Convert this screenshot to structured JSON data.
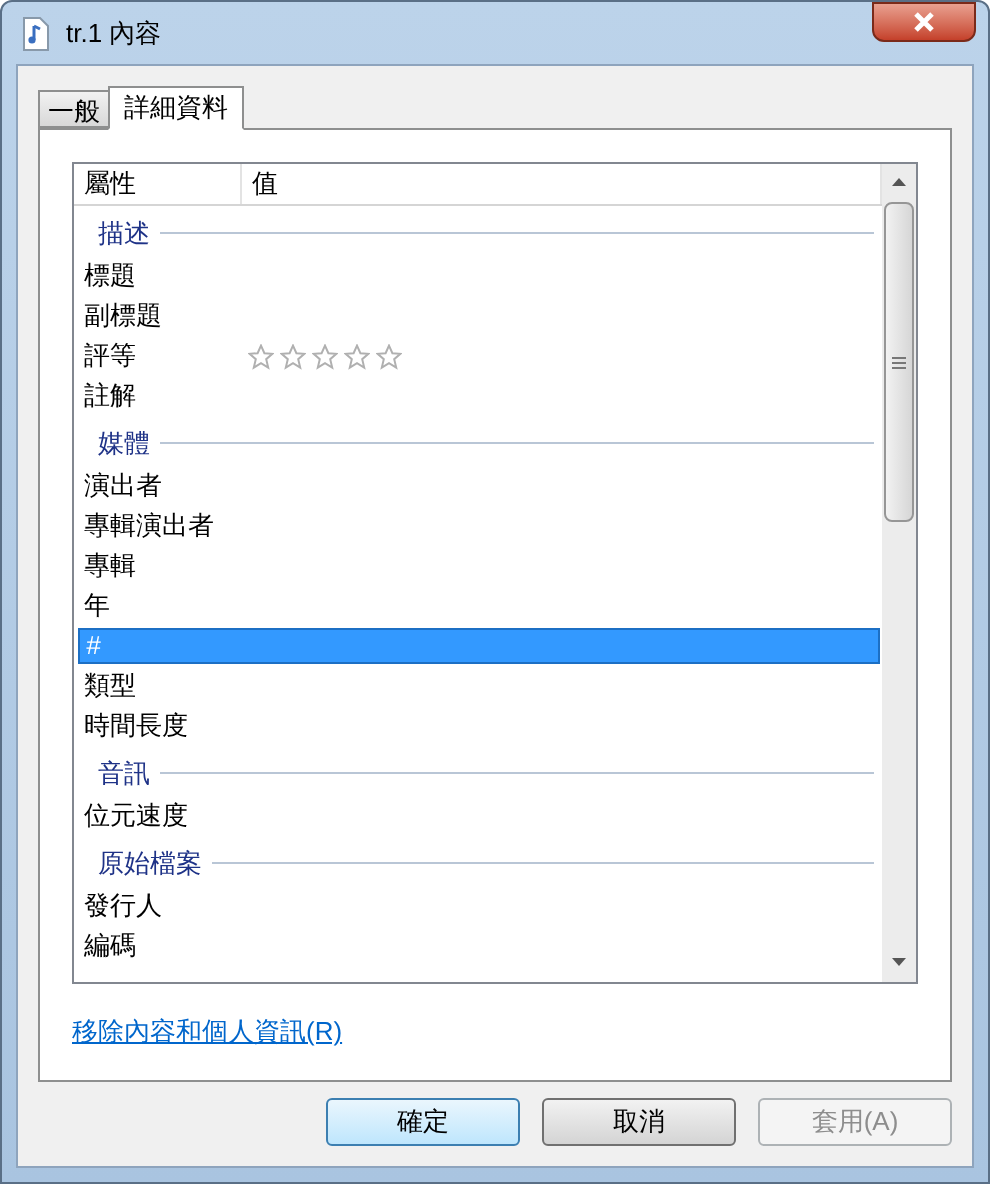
{
  "window": {
    "title": "tr.1 內容"
  },
  "tabs": [
    {
      "label": "一般",
      "selected": false
    },
    {
      "label": "詳細資料",
      "selected": true
    }
  ],
  "list": {
    "columns": [
      "屬性",
      "值"
    ],
    "rows": [
      {
        "kind": "group",
        "label": "描述"
      },
      {
        "kind": "property",
        "label": "標題",
        "selected": false
      },
      {
        "kind": "property",
        "label": "副標題",
        "selected": false
      },
      {
        "kind": "rating",
        "label": "評等",
        "stars": 0,
        "selected": false
      },
      {
        "kind": "property",
        "label": "註解",
        "selected": false
      },
      {
        "kind": "group",
        "label": "媒體"
      },
      {
        "kind": "property",
        "label": "演出者",
        "selected": false
      },
      {
        "kind": "property",
        "label": "專輯演出者",
        "selected": false
      },
      {
        "kind": "property",
        "label": "專輯",
        "selected": false
      },
      {
        "kind": "property",
        "label": "年",
        "selected": false
      },
      {
        "kind": "property",
        "label": "#",
        "selected": true
      },
      {
        "kind": "property",
        "label": "類型",
        "selected": false
      },
      {
        "kind": "property",
        "label": "時間長度",
        "selected": false
      },
      {
        "kind": "group",
        "label": "音訊"
      },
      {
        "kind": "property",
        "label": "位元速度",
        "selected": false
      },
      {
        "kind": "group",
        "label": "原始檔案"
      },
      {
        "kind": "property",
        "label": "發行人",
        "selected": false
      },
      {
        "kind": "property",
        "label": "編碼",
        "selected": false
      }
    ]
  },
  "link": "移除內容和個人資訊(R)",
  "buttons": [
    {
      "label": "確定",
      "default": true,
      "disabled": false
    },
    {
      "label": "取消",
      "default": false,
      "disabled": false
    },
    {
      "label": "套用(A)",
      "default": false,
      "disabled": true
    }
  ]
}
